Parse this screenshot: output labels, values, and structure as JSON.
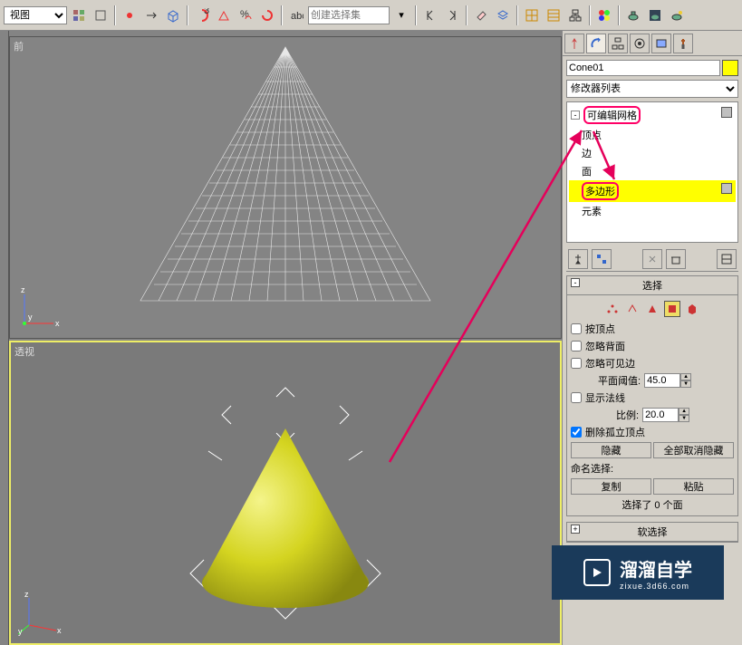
{
  "toolbar": {
    "view_dropdown": "视图",
    "selset_placeholder": "创建选择集"
  },
  "viewports": {
    "front": "前",
    "persp": "透视"
  },
  "rpanel": {
    "object_name": "Cone01",
    "modifier_list": "修改器列表",
    "stack": {
      "root": "可编辑网格",
      "vertex": "顶点",
      "edge": "边",
      "face": "面",
      "polygon": "多边形",
      "element": "元素"
    }
  },
  "rollout_select": {
    "title": "选择",
    "by_vertex": "按顶点",
    "ignore_bf": "忽略背面",
    "ignore_vis": "忽略可见边",
    "planar_label": "平面阈值:",
    "planar_val": "45.0",
    "show_norm": "显示法线",
    "scale_label": "比例:",
    "scale_val": "20.0",
    "del_iso": "删除孤立顶点",
    "hide": "隐藏",
    "unhide_all": "全部取消隐藏",
    "named_sel": "命名选择:",
    "copy": "复制",
    "paste": "粘贴",
    "sel_count": "选择了 0 个面"
  },
  "rollout_soft": {
    "title": "软选择"
  },
  "watermark": {
    "main": "溜溜自学",
    "sub": "zixue.3d66.com"
  }
}
